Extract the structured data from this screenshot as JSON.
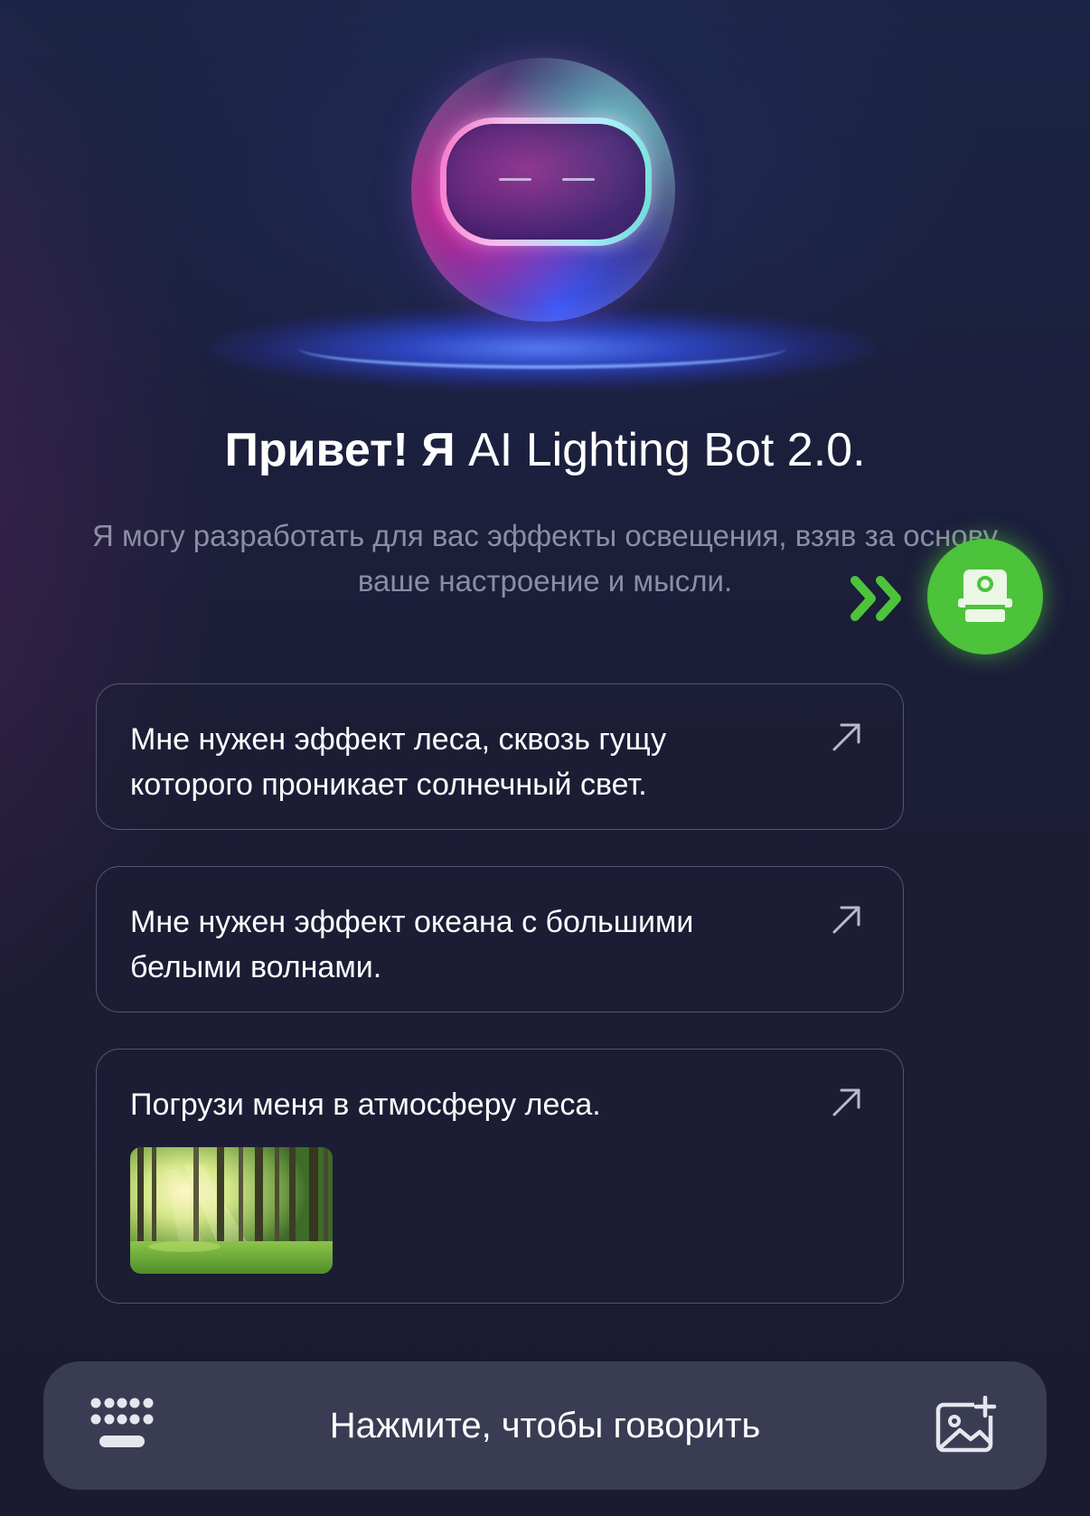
{
  "header": {
    "title_bold": "Привет! Я",
    "title_rest": "AI Lighting Bot 2.0.",
    "subtitle": "Я могу разработать для вас эффекты освещения, взяв за основу ваше настроение и мысли."
  },
  "suggestions": [
    {
      "text": "Мне нужен эффект леса, сквозь гущу которого проникает солнечный свет.",
      "icon": "arrow-up-right-icon"
    },
    {
      "text": "Мне нужен эффект океана с большими белыми волнами.",
      "icon": "arrow-up-right-icon"
    },
    {
      "text": "Погрузи меня в атмосферу леса.",
      "icon": "arrow-up-right-icon",
      "thumbnail": "forest-sunlight-image"
    }
  ],
  "bottom_bar": {
    "talk_label": "Нажмите, чтобы говорить",
    "left_icon": "keyboard-icon",
    "right_icon": "add-image-icon"
  },
  "floating_assistant": {
    "icon": "camera-device-icon"
  },
  "colors": {
    "background_top": "#1b2545",
    "background_bottom": "#1a1b30",
    "accent_green": "#4cc33a",
    "subtitle_gray": "#8c8ea4",
    "bar_background": "#393c52"
  }
}
